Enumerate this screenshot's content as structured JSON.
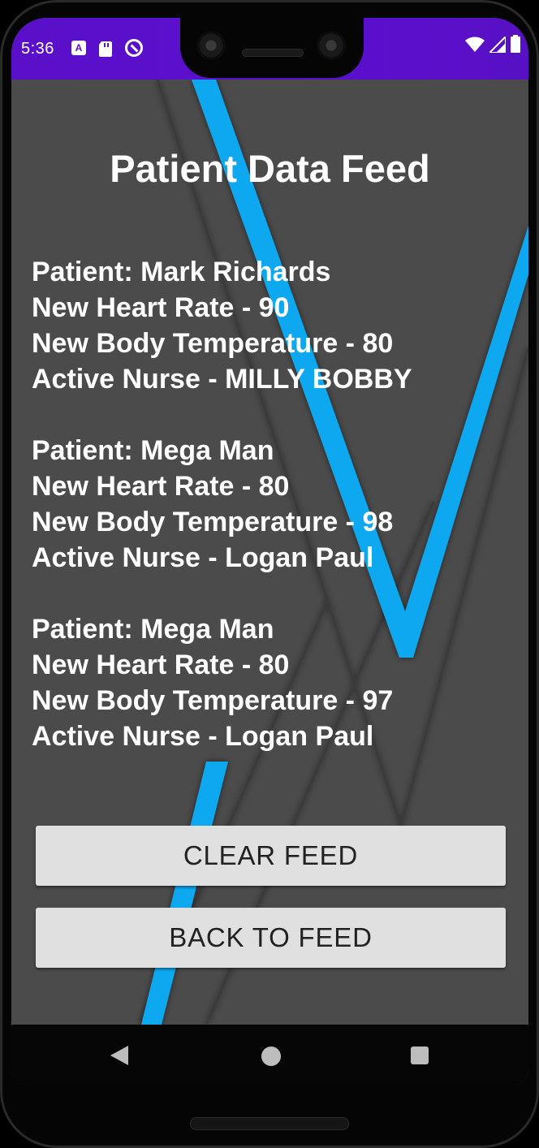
{
  "status_bar": {
    "time": "5:36"
  },
  "screen": {
    "title": "Patient Data Feed"
  },
  "feed": [
    {
      "patient": "Patient: Mark Richards",
      "heart_rate": "New Heart Rate - 90",
      "body_temp": "New Body Temperature - 80",
      "nurse": "Active Nurse - MILLY BOBBY"
    },
    {
      "patient": "Patient: Mega Man",
      "heart_rate": "New Heart Rate - 80",
      "body_temp": "New Body Temperature - 98",
      "nurse": "Active Nurse - Logan Paul"
    },
    {
      "patient": "Patient: Mega Man",
      "heart_rate": "New Heart Rate - 80",
      "body_temp": "New Body Temperature - 97",
      "nurse": "Active Nurse - Logan Paul"
    }
  ],
  "buttons": {
    "clear": "CLEAR FEED",
    "back": "BACK TO FEED"
  },
  "colors": {
    "status_bar": "#5b0fcf",
    "accent_stripe": "#0aa8f0",
    "background": "#4b4b4b",
    "button": "#e0e0e0"
  },
  "icons": [
    "android-a-icon",
    "sd-card-icon",
    "dnd-icon",
    "wifi-icon",
    "signal-icon",
    "battery-icon",
    "nav-back-icon",
    "nav-home-icon",
    "nav-recent-icon"
  ]
}
